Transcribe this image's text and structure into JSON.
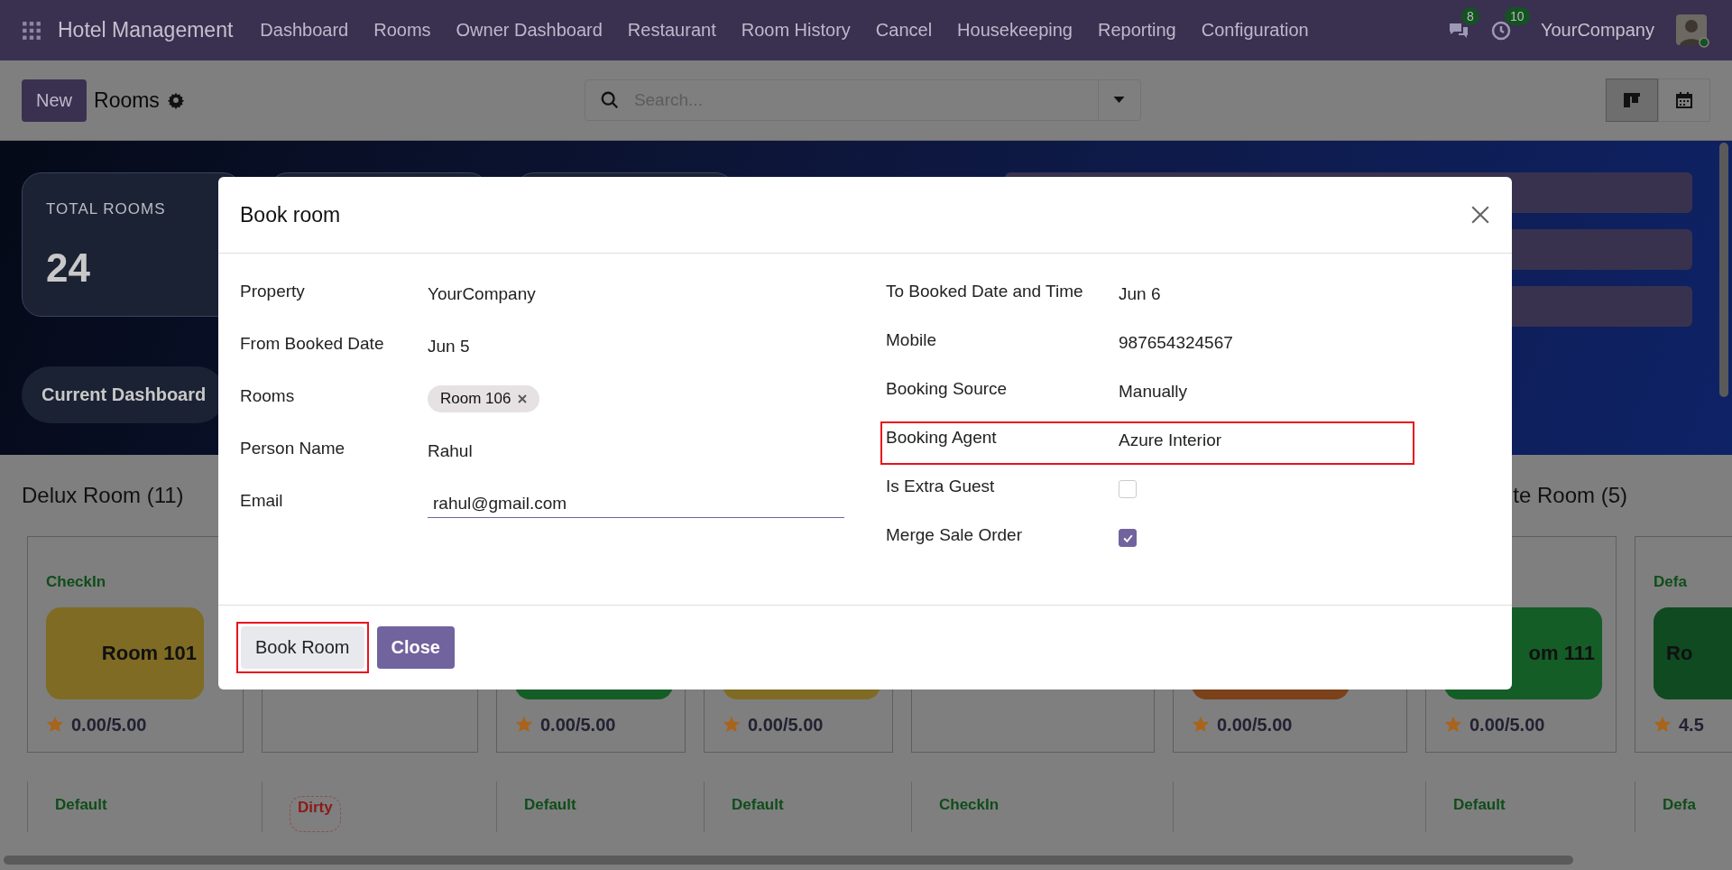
{
  "navbar": {
    "app_title": "Hotel Management",
    "menu": [
      "Dashboard",
      "Rooms",
      "Owner Dashboard",
      "Restaurant",
      "Room History",
      "Cancel",
      "Housekeeping",
      "Reporting",
      "Configuration"
    ],
    "messages_badge": "8",
    "activities_badge": "10",
    "company": "YourCompany"
  },
  "control_panel": {
    "new_button": "New",
    "title": "Rooms",
    "search": {
      "placeholder": "Search..."
    },
    "views": [
      {
        "kind": "kanban",
        "selected": true
      },
      {
        "kind": "calendar",
        "selected": false
      }
    ]
  },
  "dashboard": {
    "stat": {
      "label": "TOTAL ROOMS",
      "value": "24"
    },
    "current_button": "Current Dashboard"
  },
  "groups": [
    {
      "title": "Delux Room (11)"
    },
    {
      "title": "te Room (5)"
    }
  ],
  "cards": [
    {
      "kind": "room",
      "status": "CheckIn",
      "alert": false,
      "color": "#7f6b24",
      "room": "Room 101",
      "rating": "0.00/5.00"
    },
    {
      "kind": "empty"
    },
    {
      "kind": "room",
      "color": "#155d27",
      "rating": "0.00/5.00"
    },
    {
      "kind": "room",
      "color": "#7f6b24",
      "rating": "0.00/5.00"
    },
    {
      "kind": "empty"
    },
    {
      "kind": "room",
      "color": "#7a411a",
      "rating": "0.00/5.00"
    },
    {
      "kind": "room",
      "color": "#155d27",
      "room": "om 111",
      "rating": "0.00/5.00"
    },
    {
      "kind": "room",
      "status": "Defa",
      "alert": false,
      "color": "#0f4a20",
      "room": "Ro",
      "rating": "4.5"
    }
  ],
  "cards_row2": [
    {
      "kind": "room",
      "status": "Default",
      "alert": false
    },
    {
      "kind": "room",
      "status": "Dirty",
      "alert": true
    },
    {
      "kind": "room",
      "status": "Default",
      "alert": false
    },
    {
      "kind": "room",
      "status": "Default",
      "alert": false
    },
    {
      "kind": "room",
      "status": "CheckIn",
      "alert": false
    },
    {
      "kind": "empty"
    },
    {
      "kind": "room",
      "status": "Default",
      "alert": false
    },
    {
      "kind": "room",
      "status": "Defa",
      "alert": false
    }
  ],
  "dialog": {
    "title": "Book room",
    "left_fields": [
      {
        "label": "Property",
        "kind": "text",
        "value": "YourCompany",
        "highlighted": false
      },
      {
        "label": "From Booked Date",
        "kind": "text",
        "value": "Jun 5",
        "highlighted": false
      },
      {
        "label": "Rooms",
        "kind": "tags",
        "tags": [
          "Room 106"
        ],
        "highlighted": false
      },
      {
        "label": "Person Name",
        "kind": "text",
        "value": "Rahul",
        "highlighted": false
      },
      {
        "label": "Email",
        "kind": "input",
        "value": "rahul@gmail.com",
        "highlighted": false
      }
    ],
    "right_fields": [
      {
        "label": "To Booked Date and Time",
        "kind": "text",
        "value": "Jun 6",
        "highlighted": false
      },
      {
        "label": "Mobile",
        "kind": "text",
        "value": "987654324567",
        "highlighted": false
      },
      {
        "label": "Booking Source",
        "kind": "text",
        "value": "Manually",
        "highlighted": false
      },
      {
        "label": "Booking Agent",
        "kind": "text",
        "value": "Azure Interior",
        "highlighted": true
      },
      {
        "label": "Is Extra Guest",
        "kind": "checkbox",
        "checked": false,
        "highlighted": false
      },
      {
        "label": "Merge Sale Order",
        "kind": "checkbox",
        "checked": true,
        "highlighted": false
      }
    ],
    "buttons": [
      {
        "label": "Book Room",
        "kind": "secondary",
        "highlighted": true
      },
      {
        "label": "Close",
        "kind": "primary",
        "highlighted": false
      }
    ]
  }
}
